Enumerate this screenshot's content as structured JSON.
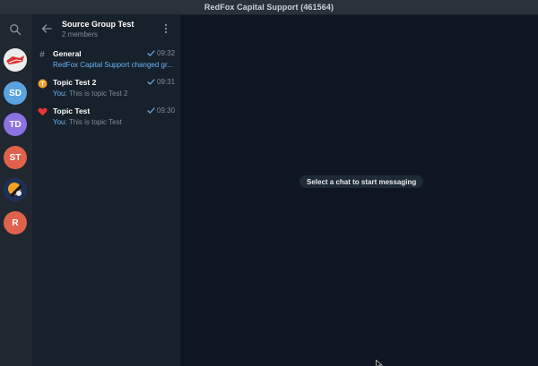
{
  "window": {
    "title": "RedFox Capital Support (461564)"
  },
  "rail": {
    "avatars": [
      {
        "initials": "",
        "icon": "redfox-logo",
        "color": "#e4e4e4"
      },
      {
        "initials": "SD",
        "color": "#5aa3e0"
      },
      {
        "initials": "TD",
        "color": "#8c73e2"
      },
      {
        "initials": "ST",
        "color": "#e0624c"
      },
      {
        "initials": "",
        "icon": "badge-logo",
        "color": "#2b4a86"
      },
      {
        "initials": "R",
        "color": "#e0624c"
      }
    ]
  },
  "group": {
    "title": "Source Group Test",
    "subtitle": "2 members"
  },
  "topics": [
    {
      "name": "General",
      "icon": "hash-icon",
      "time": "09:32",
      "sender": "",
      "preview": "RedFox Capital Support changed gr..."
    },
    {
      "name": "Topic Test 2",
      "icon": "orange-topic-icon",
      "time": "09:31",
      "sender": "You:",
      "preview": "This is topic Test 2"
    },
    {
      "name": "Topic Test",
      "icon": "heart-icon",
      "time": "09:30",
      "sender": "You:",
      "preview": "This is topic Test"
    }
  ],
  "main": {
    "empty_state": "Select a chat to start messaging"
  },
  "colors": {
    "accent": "#6ab3f3",
    "check": "#6ab3f3",
    "background": "#0e1621",
    "panel": "#17212b",
    "rail": "#1f2731"
  }
}
